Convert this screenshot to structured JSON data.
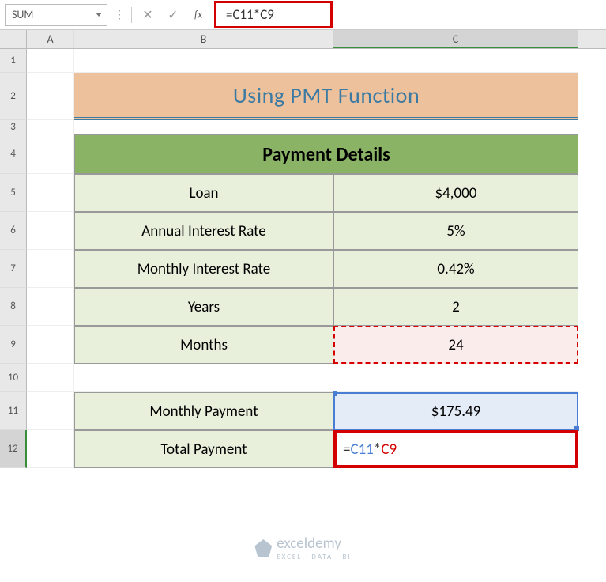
{
  "nameBox": "SUM",
  "formulaBar": "=C11*C9",
  "columns": [
    "A",
    "B",
    "C"
  ],
  "rows": [
    "1",
    "2",
    "3",
    "4",
    "5",
    "6",
    "7",
    "8",
    "9",
    "10",
    "11",
    "12"
  ],
  "title": "Using PMT Function",
  "tableHeader": "Payment Details",
  "data": {
    "loan": {
      "label": "Loan",
      "value": "$4,000"
    },
    "annualRate": {
      "label": "Annual Interest Rate",
      "value": "5%"
    },
    "monthlyRate": {
      "label": "Monthly Interest Rate",
      "value": "0.42%"
    },
    "years": {
      "label": "Years",
      "value": "2"
    },
    "months": {
      "label": "Months",
      "value": "24"
    },
    "monthlyPayment": {
      "label": "Monthly Payment",
      "value": "$175.49"
    },
    "totalPayment": {
      "label": "Total Payment",
      "value": "=C11*C9"
    }
  },
  "cellFormula": {
    "eq": "=",
    "ref1": "C11",
    "op": "*",
    "ref2": "C9"
  },
  "watermark": {
    "brand": "exceldemy",
    "sub": "EXCEL · DATA · BI"
  }
}
